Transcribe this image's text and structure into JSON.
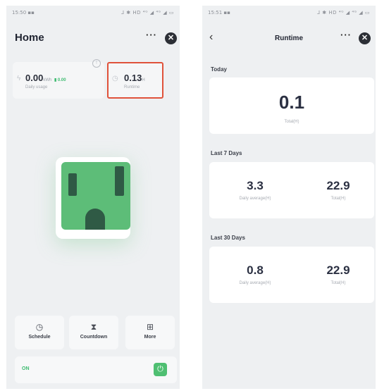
{
  "left": {
    "status": {
      "time": "15:50 ▪▪",
      "icons": "⅃ ✱ HD ⁴ᴳ ◢ ⁴ᴳ ◢ ▭"
    },
    "header": {
      "title": "Home",
      "more": "···",
      "close": "✕"
    },
    "usage": {
      "value": "0.00",
      "unit": "kWh",
      "tag": "▮ 0.00",
      "label": "Daily usage"
    },
    "runtime": {
      "value": "0.13",
      "unit": "H",
      "label": "Runtime"
    },
    "info": "!",
    "actions": [
      {
        "label": "Schedule",
        "icon": "clock-icon",
        "glyph": "◷"
      },
      {
        "label": "Countdown",
        "icon": "hourglass-icon",
        "glyph": "⧗"
      },
      {
        "label": "More",
        "icon": "grid-icon",
        "glyph": "⊞"
      }
    ],
    "power": {
      "state": "ON",
      "glyph": "⏻"
    }
  },
  "right": {
    "status": {
      "time": "15:51 ▪▪",
      "icons": "⅃ ✱ HD ⁴ᴳ ◢ ⁴ᴳ ◢ ▭"
    },
    "header": {
      "back": "‹",
      "title": "Runtime",
      "more": "···",
      "close": "✕"
    },
    "today": {
      "label": "Today",
      "total_value": "0.1",
      "total_label": "Total(H)"
    },
    "last7": {
      "label": "Last 7 Days",
      "avg_value": "3.3",
      "avg_label": "Daily average(H)",
      "total_value": "22.9",
      "total_label": "Total(H)"
    },
    "last30": {
      "label": "Last 30 Days",
      "avg_value": "0.8",
      "avg_label": "Daily average(H)",
      "total_value": "22.9",
      "total_label": "Total(H)"
    }
  },
  "colors": {
    "accent_green": "#4fbf72",
    "highlight_red": "#e0523a",
    "socket": "#5dbd78"
  }
}
